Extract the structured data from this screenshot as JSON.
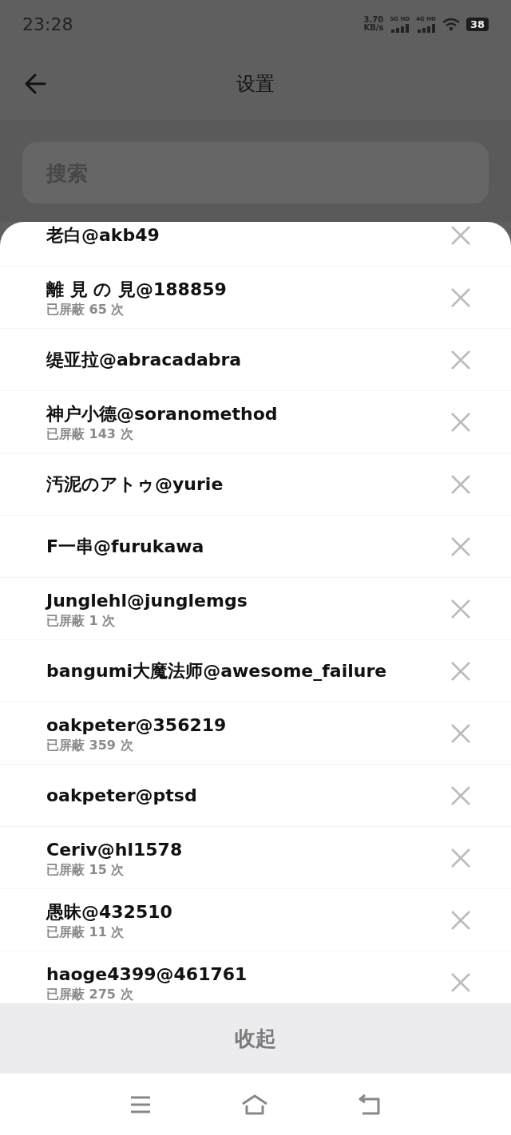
{
  "status_bar": {
    "time": "23:28",
    "speed_value": "3.70",
    "speed_unit": "KB/s",
    "sim_1": "5G HD",
    "sim_2": "4G HD",
    "battery": "38"
  },
  "header": {
    "title": "设置"
  },
  "search": {
    "placeholder": "搜索"
  },
  "blocked_users": [
    {
      "name": "老白@akb49"
    },
    {
      "name": "離 見 の 見@188859",
      "count": "已屏蔽 65 次"
    },
    {
      "name": "缇亚拉@abracadabra"
    },
    {
      "name": "神户小德@soranomethod",
      "count": "已屏蔽 143 次"
    },
    {
      "name": "汚泥のアトゥ@yurie"
    },
    {
      "name": "F一串@furukawa"
    },
    {
      "name": "Junglehl@junglemgs",
      "count": "已屏蔽 1 次"
    },
    {
      "name": "bangumi大魔法师@awesome_failure"
    },
    {
      "name": "oakpeter@356219",
      "count": "已屏蔽 359 次"
    },
    {
      "name": "oakpeter@ptsd"
    },
    {
      "name": "Ceriv@hl1578",
      "count": "已屏蔽 15 次"
    },
    {
      "name": "愚昧@432510",
      "count": "已屏蔽 11 次"
    },
    {
      "name": "haoge4399@461761",
      "count": "已屏蔽 275 次"
    }
  ],
  "collapse_button": "收起"
}
